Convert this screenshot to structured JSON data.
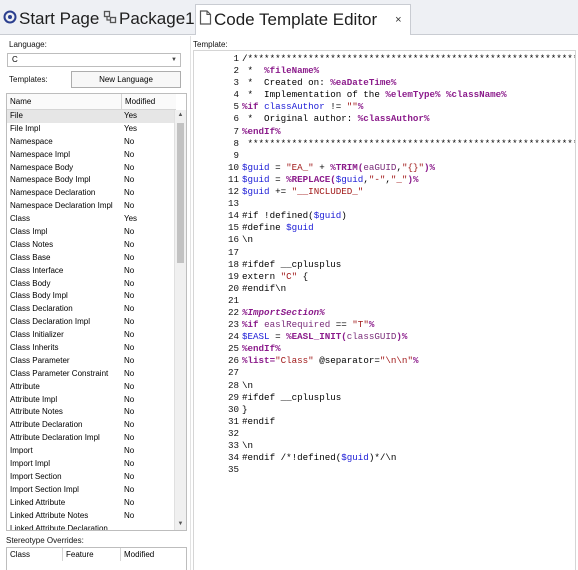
{
  "tabs": [
    {
      "label": "Start Page",
      "icon": "start-page-icon"
    },
    {
      "label": "Package1",
      "icon": "package-icon"
    },
    {
      "label": "Code Template Editor",
      "icon": "template-editor-icon",
      "close": "×"
    }
  ],
  "left": {
    "language_label": "Language:",
    "language_value": "C",
    "templates_label": "Templates:",
    "new_language_button": "New Language",
    "columns": [
      "Name",
      "Modified"
    ],
    "rows": [
      {
        "name": "File",
        "modified": "Yes"
      },
      {
        "name": "File Impl",
        "modified": "Yes"
      },
      {
        "name": "Namespace",
        "modified": "No"
      },
      {
        "name": "Namespace Impl",
        "modified": "No"
      },
      {
        "name": "Namespace Body",
        "modified": "No"
      },
      {
        "name": "Namespace Body Impl",
        "modified": "No"
      },
      {
        "name": "Namespace Declaration",
        "modified": "No"
      },
      {
        "name": "Namespace Declaration Impl",
        "modified": "No"
      },
      {
        "name": "Class",
        "modified": "Yes"
      },
      {
        "name": "Class Impl",
        "modified": "No"
      },
      {
        "name": "Class Notes",
        "modified": "No"
      },
      {
        "name": "Class Base",
        "modified": "No"
      },
      {
        "name": "Class Interface",
        "modified": "No"
      },
      {
        "name": "Class Body",
        "modified": "No"
      },
      {
        "name": "Class Body Impl",
        "modified": "No"
      },
      {
        "name": "Class Declaration",
        "modified": "No"
      },
      {
        "name": "Class Declaration Impl",
        "modified": "No"
      },
      {
        "name": "Class Initializer",
        "modified": "No"
      },
      {
        "name": "Class Inherits",
        "modified": "No"
      },
      {
        "name": "Class Parameter",
        "modified": "No"
      },
      {
        "name": "Class Parameter Constraint",
        "modified": "No"
      },
      {
        "name": "Attribute",
        "modified": "No"
      },
      {
        "name": "Attribute Impl",
        "modified": "No"
      },
      {
        "name": "Attribute Notes",
        "modified": "No"
      },
      {
        "name": "Attribute Declaration",
        "modified": "No"
      },
      {
        "name": "Attribute Declaration Impl",
        "modified": "No"
      },
      {
        "name": "Import",
        "modified": "No"
      },
      {
        "name": "Import Impl",
        "modified": "No"
      },
      {
        "name": "Import Section",
        "modified": "No"
      },
      {
        "name": "Import Section Impl",
        "modified": "No"
      },
      {
        "name": "Linked Attribute",
        "modified": "No"
      },
      {
        "name": "Linked Attribute Notes",
        "modified": "No"
      },
      {
        "name": "Linked Attribute Declaration",
        "modified": ""
      }
    ],
    "stereotype_label": "Stereotype Overrides:",
    "stereotype_columns": [
      "Class",
      "Feature",
      "Modified"
    ]
  },
  "template_label": "Template:",
  "code": [
    [
      {
        "t": "/*************************************************************"
      }
    ],
    [
      {
        "t": " *  "
      },
      {
        "t": "%fileName%",
        "c": "k"
      }
    ],
    [
      {
        "t": " *  Created on: "
      },
      {
        "t": "%eaDateTime%",
        "c": "k"
      }
    ],
    [
      {
        "t": " *  Implementation of the "
      },
      {
        "t": "%elemType%",
        "c": "k"
      },
      {
        "t": " "
      },
      {
        "t": "%className%",
        "c": "k"
      }
    ],
    [
      {
        "t": "%if ",
        "c": "k"
      },
      {
        "t": "classAuthor",
        "c": "v"
      },
      {
        "t": " != "
      },
      {
        "t": "\"\"",
        "c": "s"
      },
      {
        "t": "%",
        "c": "k"
      }
    ],
    [
      {
        "t": " *  Original author: "
      },
      {
        "t": "%classAuthor%",
        "c": "k"
      }
    ],
    [
      {
        "t": "%endIf%",
        "c": "k"
      }
    ],
    [
      {
        "t": " **************************************************************/\\n"
      }
    ],
    [
      {
        "t": ""
      }
    ],
    [
      {
        "t": "$guid",
        "c": "v"
      },
      {
        "t": " = "
      },
      {
        "t": "\"EA_\"",
        "c": "s"
      },
      {
        "t": " + "
      },
      {
        "t": "%TRIM(",
        "c": "k"
      },
      {
        "t": "eaGUID",
        "c": "f"
      },
      {
        "t": ","
      },
      {
        "t": "\"{}\"",
        "c": "s"
      },
      {
        "t": ")%",
        "c": "k"
      }
    ],
    [
      {
        "t": "$guid",
        "c": "v"
      },
      {
        "t": " = "
      },
      {
        "t": "%REPLACE(",
        "c": "k"
      },
      {
        "t": "$guid",
        "c": "v"
      },
      {
        "t": ","
      },
      {
        "t": "\"-\"",
        "c": "s"
      },
      {
        "t": ","
      },
      {
        "t": "\"_\"",
        "c": "s"
      },
      {
        "t": ")%",
        "c": "k"
      }
    ],
    [
      {
        "t": "$guid",
        "c": "v"
      },
      {
        "t": " += "
      },
      {
        "t": "\"__INCLUDED_\"",
        "c": "s"
      }
    ],
    [
      {
        "t": ""
      }
    ],
    [
      {
        "t": "#if !defined("
      },
      {
        "t": "$guid",
        "c": "v"
      },
      {
        "t": ")"
      }
    ],
    [
      {
        "t": "#define "
      },
      {
        "t": "$guid",
        "c": "v"
      }
    ],
    [
      {
        "t": "\\n"
      }
    ],
    [
      {
        "t": ""
      }
    ],
    [
      {
        "t": "#ifdef __cplusplus"
      }
    ],
    [
      {
        "t": "extern "
      },
      {
        "t": "\"C\"",
        "c": "s"
      },
      {
        "t": " {"
      }
    ],
    [
      {
        "t": "#endif\\n"
      }
    ],
    [
      {
        "t": ""
      }
    ],
    [
      {
        "t": "%ImportSection%",
        "c": "i"
      }
    ],
    [
      {
        "t": "%if ",
        "c": "k"
      },
      {
        "t": "easlRequired",
        "c": "f"
      },
      {
        "t": " == "
      },
      {
        "t": "\"T\"",
        "c": "s"
      },
      {
        "t": "%",
        "c": "k"
      }
    ],
    [
      {
        "t": "$EASL",
        "c": "v"
      },
      {
        "t": " = "
      },
      {
        "t": "%EASL_INIT(",
        "c": "k"
      },
      {
        "t": "classGUID",
        "c": "f"
      },
      {
        "t": ")%",
        "c": "k"
      }
    ],
    [
      {
        "t": "%endIf%",
        "c": "k"
      }
    ],
    [
      {
        "t": "%list=",
        "c": "k"
      },
      {
        "t": "\"Class\"",
        "c": "s"
      },
      {
        "t": " @separator="
      },
      {
        "t": "\"\\n\\n\"",
        "c": "s"
      },
      {
        "t": "%",
        "c": "k"
      }
    ],
    [
      {
        "t": ""
      }
    ],
    [
      {
        "t": "\\n"
      }
    ],
    [
      {
        "t": "#ifdef __cplusplus"
      }
    ],
    [
      {
        "t": "}"
      }
    ],
    [
      {
        "t": "#endif"
      }
    ],
    [
      {
        "t": ""
      }
    ],
    [
      {
        "t": "\\n"
      }
    ],
    [
      {
        "t": "#endif /*!defined("
      },
      {
        "t": "$guid",
        "c": "v"
      },
      {
        "t": ")*/\\n"
      }
    ],
    [
      {
        "t": ""
      }
    ]
  ]
}
